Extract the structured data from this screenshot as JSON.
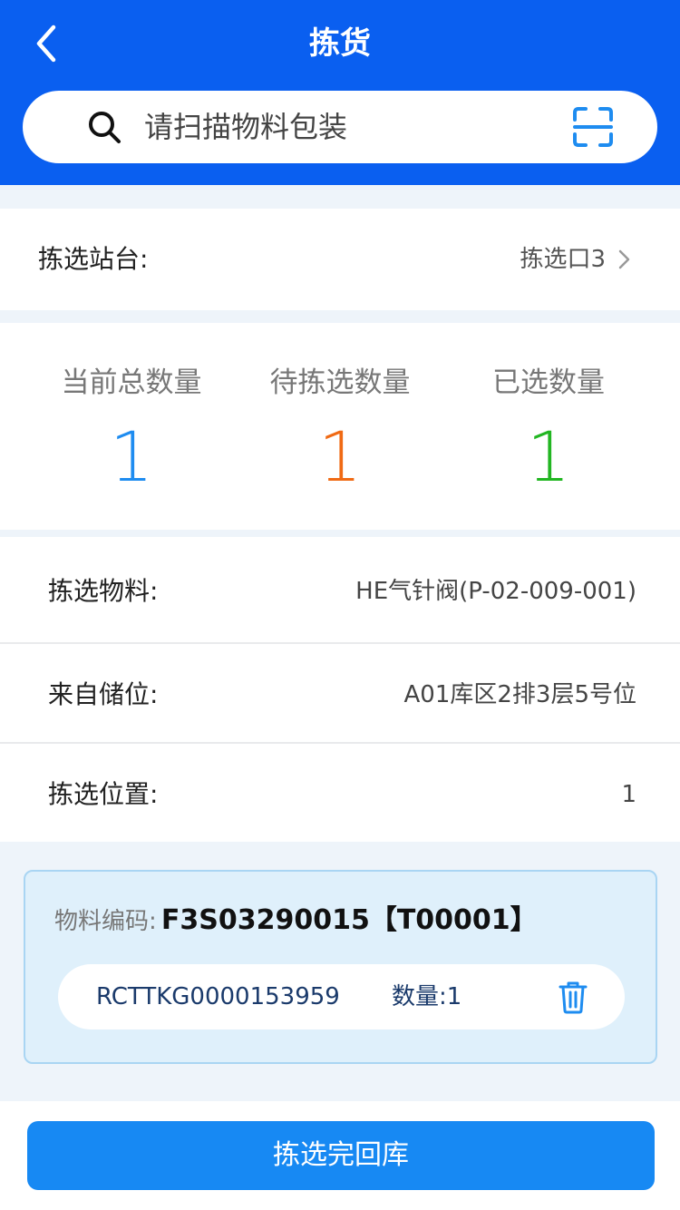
{
  "header": {
    "title": "拣货",
    "back_icon": "chevron-left-icon",
    "background_color": "#0a5ff0"
  },
  "search": {
    "placeholder": "请扫描物料包装",
    "value": "",
    "search_icon": "search-icon",
    "scan_icon": "scan-icon"
  },
  "station": {
    "label": "拣选站台:",
    "value": "拣选口3"
  },
  "stats": [
    {
      "label": "当前总数量",
      "value": "1",
      "color": "#1e8cf0"
    },
    {
      "label": "待拣选数量",
      "value": "1",
      "color": "#f06a14"
    },
    {
      "label": "已选数量",
      "value": "1",
      "color": "#22b622"
    }
  ],
  "details": [
    {
      "label": "拣选物料:",
      "value": "HE气针阀(P-02-009-001)"
    },
    {
      "label": "来自储位:",
      "value": "A01库区2排3层5号位"
    },
    {
      "label": "拣选位置:",
      "value": "1"
    }
  ],
  "material": {
    "label": "物料编码:",
    "code": "F3S03290015【T00001】",
    "barcode": "RCTTKG0000153959",
    "quantity_text": "数量:1",
    "delete_icon": "trash-icon"
  },
  "footer": {
    "button_label": "拣选完回库"
  }
}
